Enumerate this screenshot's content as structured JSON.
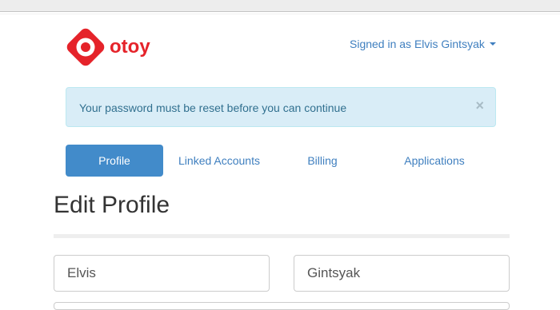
{
  "brand": {
    "name": "otoy",
    "color": "#e5232a"
  },
  "header": {
    "user_menu_label": "Signed in as Elvis Gintsyak"
  },
  "alert": {
    "message": "Your password must be reset before you can continue",
    "close_label": "×"
  },
  "tabs": [
    {
      "label": "Profile",
      "active": true
    },
    {
      "label": "Linked Accounts",
      "active": false
    },
    {
      "label": "Billing",
      "active": false
    },
    {
      "label": "Applications",
      "active": false
    }
  ],
  "page": {
    "title": "Edit Profile"
  },
  "form": {
    "first_name": {
      "value": "Elvis"
    },
    "last_name": {
      "value": "Gintsyak"
    }
  },
  "colors": {
    "link": "#3f7fbf",
    "primary": "#428bca",
    "alert_bg": "#d9edf7",
    "alert_text": "#31708f"
  }
}
